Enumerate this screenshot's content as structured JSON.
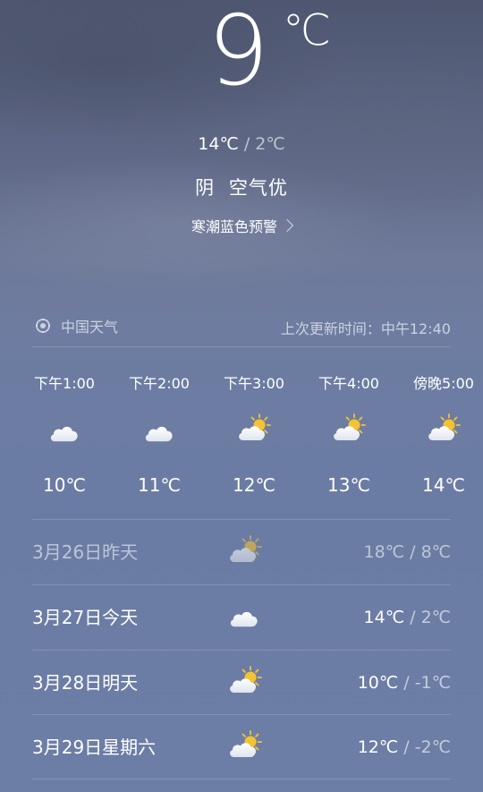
{
  "current": {
    "temp": "9",
    "unit": "℃",
    "high": "14℃",
    "low": "2℃",
    "range_sep": "/",
    "condition": "阴",
    "air_quality": "空气优",
    "alert": "寒潮蓝色预警"
  },
  "source": {
    "name": "中国天气",
    "updated": "上次更新时间：中午12:40"
  },
  "hourly": [
    {
      "time": "下午1:00",
      "icon": "cloud-icon",
      "temp": "10℃"
    },
    {
      "time": "下午2:00",
      "icon": "cloud-icon",
      "temp": "11℃"
    },
    {
      "time": "下午3:00",
      "icon": "partly-sunny-icon",
      "temp": "12℃"
    },
    {
      "time": "下午4:00",
      "icon": "partly-sunny-icon",
      "temp": "13℃"
    },
    {
      "time": "傍晚5:00",
      "icon": "partly-sunny-icon",
      "temp": "14℃"
    }
  ],
  "daily": [
    {
      "date": "3月26日昨天",
      "icon": "partly-sunny-icon",
      "high": "18℃",
      "low": "8℃",
      "past": true
    },
    {
      "date": "3月27日今天",
      "icon": "cloud-icon",
      "high": "14℃",
      "low": "2℃"
    },
    {
      "date": "3月28日明天",
      "icon": "partly-sunny-icon",
      "high": "10℃",
      "low": "-1℃"
    },
    {
      "date": "3月29日星期六",
      "icon": "partly-sunny-icon",
      "high": "12℃",
      "low": "-2℃"
    }
  ],
  "colors": {
    "sun": "#f5c330",
    "cloud": "#ffffff"
  }
}
